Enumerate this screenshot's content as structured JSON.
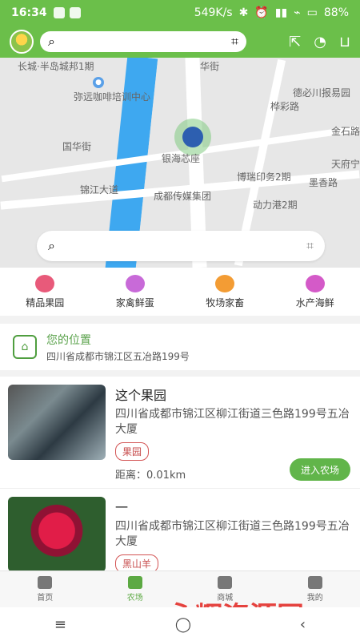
{
  "status": {
    "time": "16:34",
    "network": "549K/s",
    "battery": "88%"
  },
  "top": {
    "search_placeholder": "",
    "scan_icon": "scan-icon"
  },
  "map": {
    "labels": [
      "长城·半岛城邦1期",
      "弥远咖啡培训中心",
      "国华街",
      "银海芯座",
      "博瑞印务2期",
      "成都传媒集团",
      "动力港2期",
      "锦江大道",
      "德必川报易园",
      "金石路",
      "天府宁",
      "墨香路",
      "桦彩路",
      "华街"
    ],
    "search_placeholder": "",
    "search_icon": "search-icon"
  },
  "categories": [
    {
      "label": "精品果园",
      "color": "#e85a7a"
    },
    {
      "label": "家禽鲜蛋",
      "color": "#c86ad8"
    },
    {
      "label": "牧场家畜",
      "color": "#f39c34"
    },
    {
      "label": "水产海鲜",
      "color": "#d45ac8"
    }
  ],
  "location": {
    "title": "您的位置",
    "address": "四川省成都市锦江区五冶路199号"
  },
  "farms": [
    {
      "name": "这个果园",
      "address": "四川省成都市锦江区柳江街道三色路199号五冶大厦",
      "tag": "果园",
      "distance": "距离：0.01km",
      "button": "进入农场"
    },
    {
      "name": "一",
      "address": "四川省成都市锦江区柳江街道三色路199号五冶大厦",
      "tag": "黑山羊",
      "distance": "",
      "button": ""
    }
  ],
  "tabbar": [
    {
      "label": "首页"
    },
    {
      "label": "农场"
    },
    {
      "label": "商城"
    },
    {
      "label": "我的"
    }
  ],
  "watermark": "永辉资源网"
}
